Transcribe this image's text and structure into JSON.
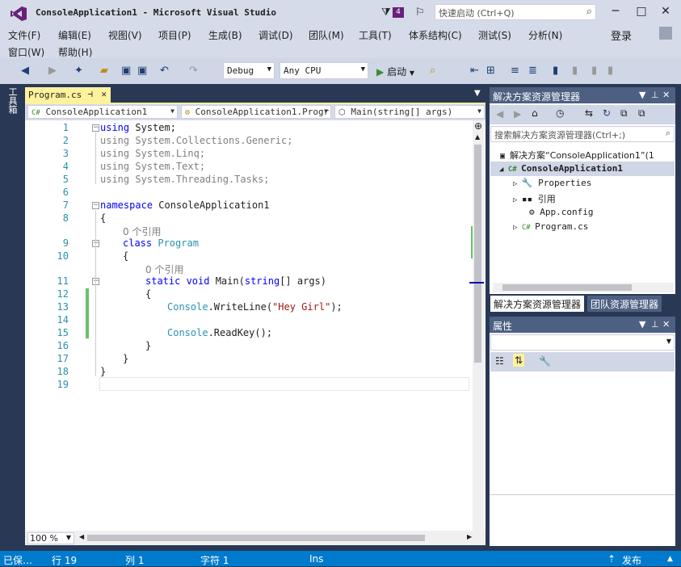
{
  "window": {
    "title": "ConsoleApplication1 - Microsoft Visual Studio",
    "notifications": "4",
    "quick_launch_placeholder": "快速启动 (Ctrl+Q)",
    "controls": [
      "─",
      "□",
      "✕"
    ]
  },
  "menu": {
    "row1": [
      "文件(F)",
      "编辑(E)",
      "视图(V)",
      "项目(P)",
      "生成(B)",
      "调试(D)",
      "团队(M)",
      "工具(T)",
      "体系结构(C)",
      "测试(S)",
      "分析(N)"
    ],
    "row2": [
      "窗口(W)",
      "帮助(H)"
    ],
    "login": "登录"
  },
  "toolbar": {
    "config": "Debug",
    "platform": "Any CPU",
    "start": "启动"
  },
  "left_tab": "工具箱",
  "editor": {
    "tab_label": "Program.cs",
    "nav_project": "ConsoleApplication1",
    "nav_class": "ConsoleApplication1.Progr",
    "nav_member": "Main(string[] args)",
    "zoom": "100 %",
    "line_numbers": [
      "1",
      "2",
      "3",
      "4",
      "5",
      "6",
      "7",
      "8",
      "9",
      "10",
      "11",
      "12",
      "13",
      "14",
      "15",
      "16",
      "17",
      "18",
      "19"
    ],
    "codelens1": "0 个引用",
    "codelens2": "0 个引用",
    "code": {
      "l1_kw": "using",
      "l1_rest": " System;",
      "l2": "using System.Collections.Generic;",
      "l3": "using System.Linq;",
      "l4": "using System.Text;",
      "l5": "using System.Threading.Tasks;",
      "l7_kw": "namespace",
      "l7_rest": " ConsoleApplication1",
      "l8": "{",
      "l9_kw": "class",
      "l9_type": " Program",
      "l10": "{",
      "l11_kw1": "static",
      "l11_kw2": " void",
      "l11_name": " Main(",
      "l11_kw3": "string",
      "l11_rest": "[] args)",
      "l12": "{",
      "l13_type": "Console",
      "l13_mid": ".WriteLine(",
      "l13_str": "\"Hey Girl\"",
      "l13_end": ");",
      "l15_type": "Console",
      "l15_rest": ".ReadKey();",
      "l16": "}",
      "l17": "}",
      "l18": "}"
    }
  },
  "solution_explorer": {
    "title": "解决方案资源管理器",
    "search_placeholder": "搜索解决方案资源管理器(Ctrl+;)",
    "items": {
      "solution": "解决方案“ConsoleApplication1”(1",
      "project": "ConsoleApplication1",
      "properties": "Properties",
      "references": "引用",
      "appconfig": "App.config",
      "program": "Program.cs"
    },
    "tab_active": "解决方案资源管理器",
    "tab_other": "团队资源管理器"
  },
  "properties": {
    "title": "属性"
  },
  "status": {
    "state": "已保…",
    "line": "行 19",
    "col": "列 1",
    "char": "字符 1",
    "mode": "Ins",
    "publish": "发布"
  },
  "colors": {
    "accent": "#007acc",
    "chrome": "#d6dbe9",
    "panel_header": "#4d6082",
    "tab_active": "#fff29d"
  }
}
